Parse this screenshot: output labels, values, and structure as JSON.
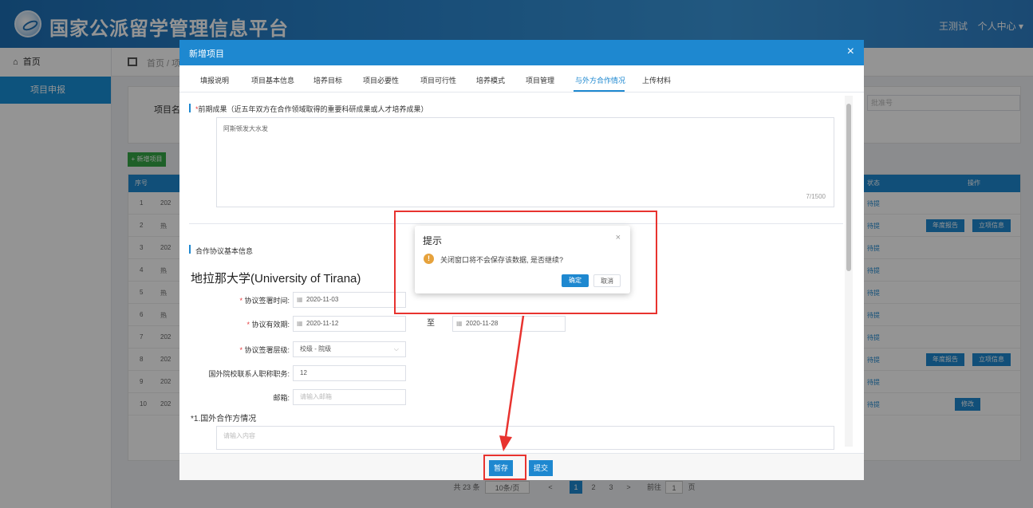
{
  "header": {
    "site_title": "国家公派留学管理信息平台",
    "user_name": "王测试",
    "user_center": "个人中心 ▾"
  },
  "sidebar": {
    "home_label": "首页",
    "items": [
      {
        "label": "项目申报"
      }
    ]
  },
  "background_page": {
    "breadcrumb": "首页 / 项",
    "search_label": "项目名称",
    "search_right_placeholder": "批准号",
    "add_button": "+ 新增项目",
    "columns": {
      "index": "序号",
      "status": "状态",
      "actions": "操作"
    },
    "rows": [
      {
        "num": "1",
        "name": "202",
        "status": "待提"
      },
      {
        "num": "2",
        "name": "热",
        "status": "待提",
        "buttons": [
          "年度报告",
          "立项信息"
        ]
      },
      {
        "num": "3",
        "name": "202",
        "status": "待提"
      },
      {
        "num": "4",
        "name": "热",
        "status": "待提"
      },
      {
        "num": "5",
        "name": "热",
        "status": "待提"
      },
      {
        "num": "6",
        "name": "热",
        "status": "待提"
      },
      {
        "num": "7",
        "name": "202",
        "status": "待提"
      },
      {
        "num": "8",
        "name": "202",
        "status": "待提",
        "buttons": [
          "年度报告",
          "立项信息"
        ]
      },
      {
        "num": "9",
        "name": "202",
        "status": "待提"
      },
      {
        "num": "10",
        "name": "202",
        "status": "待提",
        "buttons": [
          "修改"
        ]
      }
    ],
    "pagination": {
      "total": "共 23 条",
      "page_size": "10条/页",
      "prev": "<",
      "pages": [
        "1",
        "2",
        "3"
      ],
      "next": ">",
      "goto_label": "前往",
      "goto_value": "1",
      "goto_suffix": "页"
    }
  },
  "modal": {
    "title": "新增项目",
    "close": "×",
    "tabs": [
      {
        "label": "填报说明",
        "active": false
      },
      {
        "label": "项目基本信息",
        "active": false
      },
      {
        "label": "培养目标",
        "active": false
      },
      {
        "label": "项目必要性",
        "active": false
      },
      {
        "label": "项目可行性",
        "active": false
      },
      {
        "label": "培养模式",
        "active": false
      },
      {
        "label": "项目管理",
        "active": false
      },
      {
        "label": "与外方合作情况",
        "active": true
      },
      {
        "label": "上传材料",
        "active": false
      }
    ],
    "early_results": {
      "required_mark": "*",
      "label": "前期成果（近五年双方在合作领域取得的重要科研成果或人才培养成果）",
      "value": "阿斯顿发大水发",
      "counter": "7/1500"
    },
    "agreement_section": "合作协议基本信息",
    "university": "地拉那大学(University of Tirana)",
    "fields": {
      "sign_date": {
        "label": "协议签署时间:",
        "value": "2020-11-03"
      },
      "validity": {
        "label": "协议有效期:",
        "start": "2020-11-12",
        "to": "至",
        "end": "2020-11-28"
      },
      "sign_level": {
        "label": "协议签署层级:",
        "value": "校级 - 院级"
      },
      "contact_title": {
        "label": "国外院校联系人职称职务:",
        "value": "12"
      },
      "email": {
        "label": "邮箱:",
        "placeholder": "请输入邮箱"
      }
    },
    "foreign_partner": {
      "label": "*1.国外合作方情况",
      "placeholder": "请输入内容"
    },
    "footer": {
      "save": "暂存",
      "submit": "提交"
    }
  },
  "confirm_dialog": {
    "title": "提示",
    "message": "关闭窗口将不会保存该数据, 是否继续?",
    "ok": "确定",
    "cancel": "取消"
  },
  "colors": {
    "primary": "#1e88d0",
    "annotation_red": "#e8332f",
    "warning": "#e6a23c"
  }
}
